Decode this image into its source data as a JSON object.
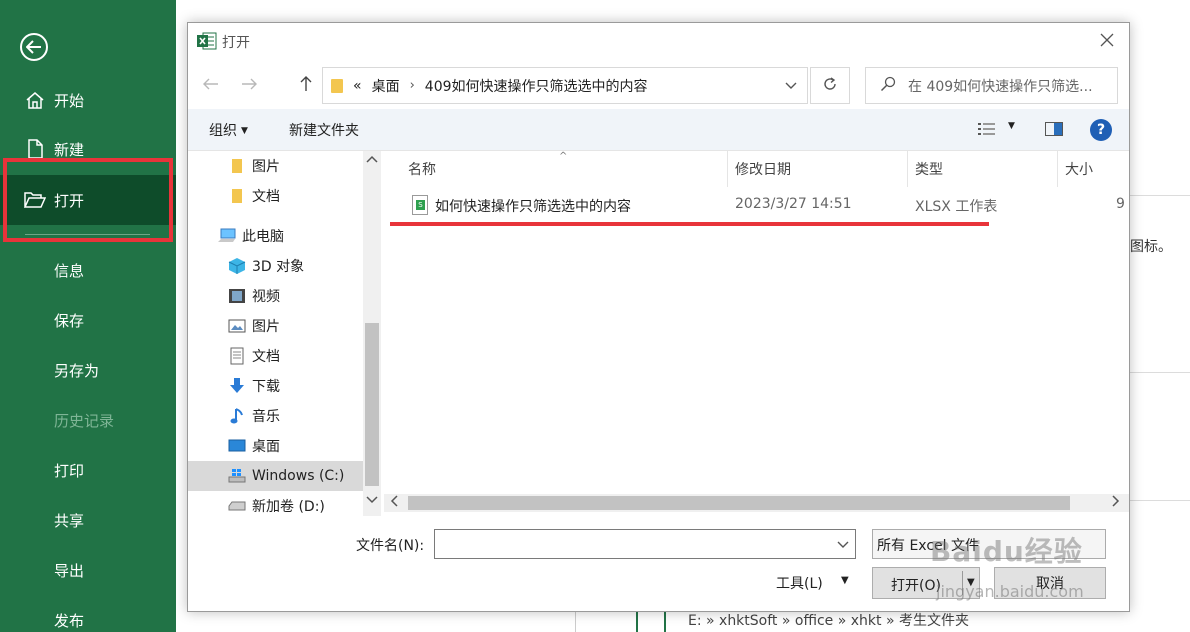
{
  "backstage": {
    "items": [
      {
        "label": "开始"
      },
      {
        "label": "新建"
      },
      {
        "label": "打开"
      },
      {
        "label": "信息"
      },
      {
        "label": "保存"
      },
      {
        "label": "另存为"
      },
      {
        "label": "历史记录"
      },
      {
        "label": "打印"
      },
      {
        "label": "共享"
      },
      {
        "label": "导出"
      },
      {
        "label": "发布"
      }
    ]
  },
  "background": {
    "right_text": "图标。",
    "recent_path": "E: » xhktSoft » office » xhkt » 考生文件夹"
  },
  "dialog": {
    "title": "打开",
    "address": {
      "overflow": "«",
      "segments": [
        "桌面",
        "409如何快速操作只筛选选中的内容"
      ]
    },
    "search_placeholder": "在 409如何快速操作只筛选...",
    "toolbar": {
      "organize": "组织",
      "new_folder": "新建文件夹",
      "help": "?"
    },
    "tree": {
      "items": [
        {
          "label": "图片",
          "icon": "folder-icon"
        },
        {
          "label": "文档",
          "icon": "folder-icon"
        },
        {
          "label": "此电脑",
          "icon": "computer-icon"
        },
        {
          "label": "3D 对象",
          "icon": "cube-icon"
        },
        {
          "label": "视频",
          "icon": "film-icon"
        },
        {
          "label": "图片",
          "icon": "picture-icon"
        },
        {
          "label": "文档",
          "icon": "document-icon"
        },
        {
          "label": "下载",
          "icon": "download-arrow-icon"
        },
        {
          "label": "音乐",
          "icon": "music-note-icon"
        },
        {
          "label": "桌面",
          "icon": "desktop-icon"
        },
        {
          "label": "Windows (C:)",
          "icon": "windows-drive-icon"
        },
        {
          "label": "新加卷 (D:)",
          "icon": "drive-icon"
        }
      ]
    },
    "columns": {
      "name": "名称",
      "modified": "修改日期",
      "type": "类型",
      "size": "大小"
    },
    "files": [
      {
        "name": "如何快速操作只筛选选中的内容",
        "modified": "2023/3/27 14:51",
        "type": "XLSX 工作表",
        "size": "9"
      }
    ],
    "filename_label": "文件名(N):",
    "filename_value": "",
    "filter_value": "所有 Excel 文件",
    "tools_label": "工具(L)",
    "open_label": "打开(O)",
    "cancel_label": "取消"
  },
  "watermark": {
    "brand": "Baidu经验",
    "url": "jingyan.baidu.com"
  },
  "colors": {
    "excel_green": "#217346",
    "active_nav": "#0e4c2a",
    "highlight_red": "#e8343a",
    "help_blue": "#1f5fb5"
  }
}
